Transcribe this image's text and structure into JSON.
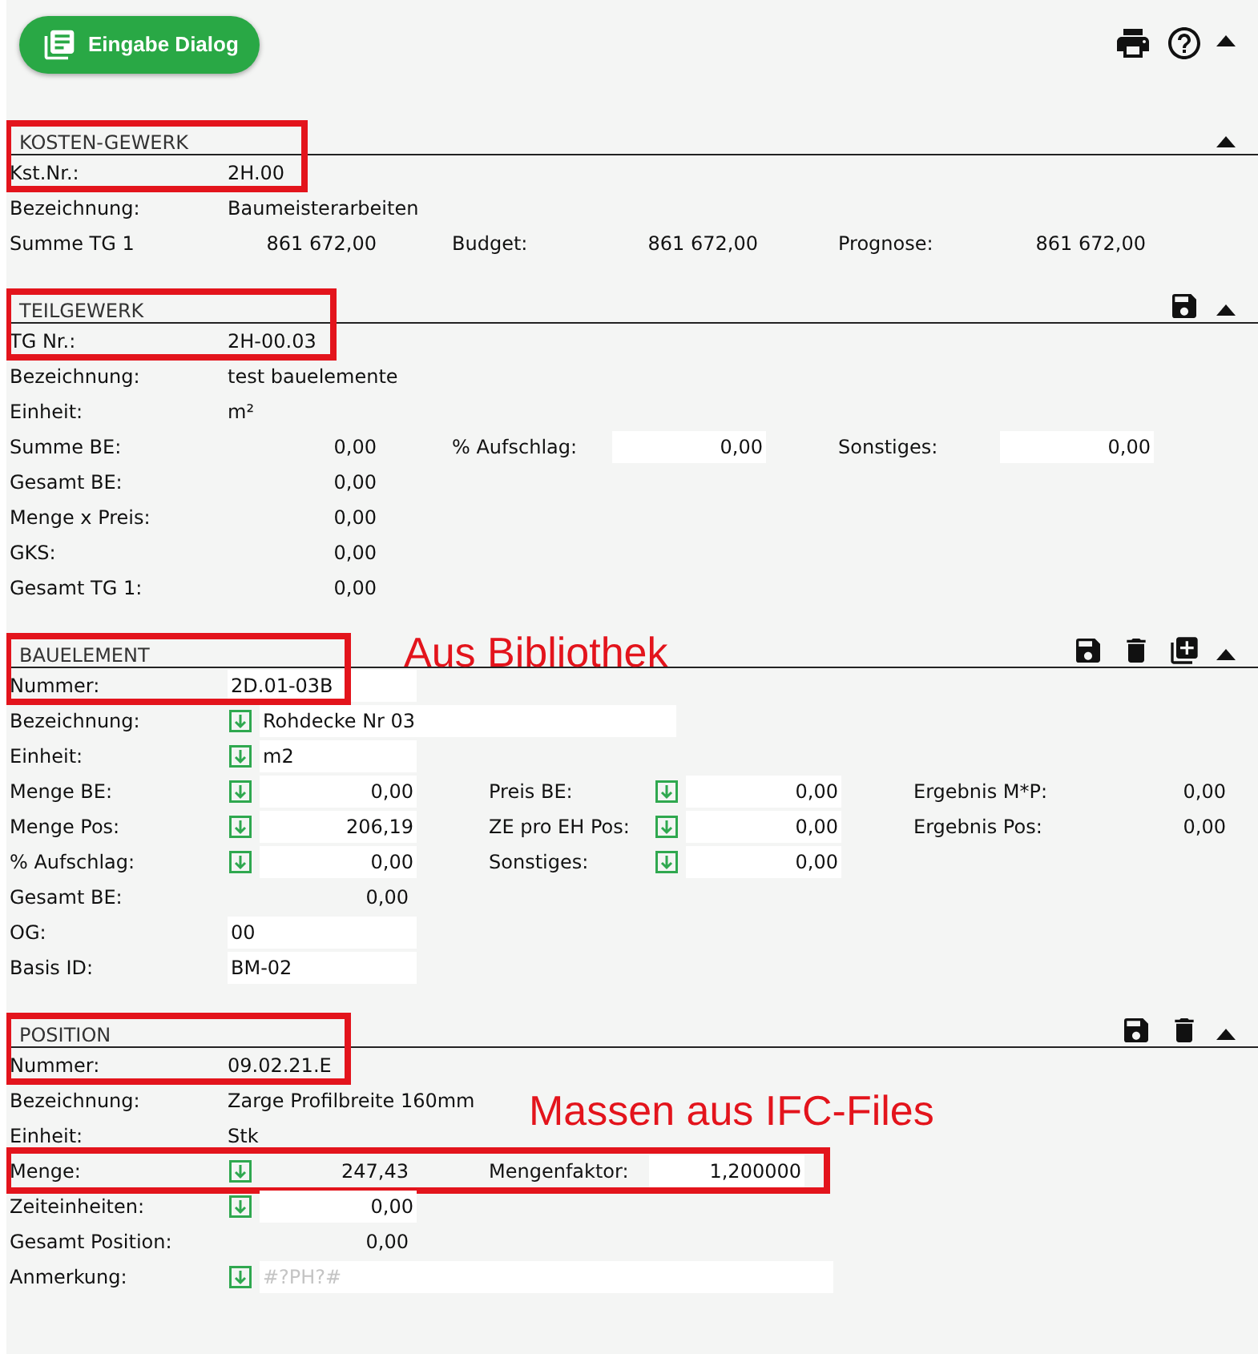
{
  "toolbar": {
    "button": "Eingabe Dialog",
    "actions": [
      {
        "kind": "print"
      },
      {
        "kind": "help"
      },
      {
        "kind": "collapse"
      }
    ]
  },
  "sections": [
    {
      "kind": "kosten",
      "title": "KOSTEN-GEWERK",
      "highlighted": true,
      "actions": [
        {
          "kind": "collapse"
        }
      ],
      "rows": [
        {
          "fields": [
            {
              "label": "Kst.Nr.:",
              "value": "2H.00",
              "kind": "text"
            }
          ]
        },
        {
          "fields": [
            {
              "label": "Bezeichnung:",
              "value": "Baumeisterarbeiten",
              "kind": "text"
            }
          ]
        },
        {
          "fields": [
            {
              "label": "Summe TG 1",
              "value": "861 672,00",
              "kind": "number"
            },
            {
              "label": "Budget:",
              "value": "861 672,00",
              "kind": "number"
            },
            {
              "label": "Prognose:",
              "value": "861 672,00",
              "kind": "number"
            }
          ]
        }
      ]
    },
    {
      "kind": "teilgewerk",
      "title": "TEILGEWERK",
      "highlighted": true,
      "actions": [
        {
          "kind": "save"
        },
        {
          "kind": "collapse"
        }
      ],
      "rows": [
        {
          "fields": [
            {
              "label": "TG Nr.:",
              "value": "2H-00.03",
              "kind": "text"
            }
          ]
        },
        {
          "fields": [
            {
              "label": "Bezeichnung:",
              "value": "test bauelemente",
              "kind": "text"
            }
          ]
        },
        {
          "fields": [
            {
              "label": "Einheit:",
              "value": "m²",
              "kind": "text"
            }
          ]
        },
        {
          "fields": [
            {
              "label": "Summe BE:",
              "value": "0,00",
              "kind": "number"
            },
            {
              "label": "% Aufschlag:",
              "value": "0,00",
              "kind": "input-number"
            },
            {
              "label": "Sonstiges:",
              "value": "0,00",
              "kind": "input-number"
            }
          ]
        },
        {
          "fields": [
            {
              "label": "Gesamt BE:",
              "value": "0,00",
              "kind": "number"
            }
          ]
        },
        {
          "fields": [
            {
              "label": "Menge x Preis:",
              "value": "0,00",
              "kind": "number"
            }
          ]
        },
        {
          "fields": [
            {
              "label": "GKS:",
              "value": "0,00",
              "kind": "number"
            }
          ]
        },
        {
          "fields": [
            {
              "label": "Gesamt TG 1:",
              "value": "0,00",
              "kind": "number"
            }
          ]
        }
      ]
    },
    {
      "kind": "bauelement",
      "title": "BAUELEMENT",
      "highlighted": true,
      "annotation": "Aus Bibliothek",
      "actions": [
        {
          "kind": "save"
        },
        {
          "kind": "delete"
        },
        {
          "kind": "add"
        },
        {
          "kind": "collapse"
        }
      ],
      "rows": [
        {
          "fields": [
            {
              "label": "Nummer:",
              "value": "2D.01-03B",
              "kind": "input-text"
            }
          ]
        },
        {
          "fields": [
            {
              "label": "Bezeichnung:",
              "value": "Rohdecke Nr 03",
              "kind": "wide-input",
              "import": true
            }
          ]
        },
        {
          "fields": [
            {
              "label": "Einheit:",
              "value": "m2",
              "kind": "input-text",
              "import": true
            }
          ]
        },
        {
          "fields": [
            {
              "label": "Menge BE:",
              "value": "0,00",
              "kind": "input-number",
              "import": true
            },
            {
              "label": "Preis BE:",
              "value": "0,00",
              "kind": "input-number",
              "import": true
            },
            {
              "label": "Ergebnis M*P:",
              "value": "0,00",
              "kind": "number"
            }
          ]
        },
        {
          "fields": [
            {
              "label": "Menge Pos:",
              "value": "206,19",
              "kind": "input-number",
              "import": true
            },
            {
              "label": "ZE pro EH Pos:",
              "value": "0,00",
              "kind": "input-number",
              "import": true
            },
            {
              "label": "Ergebnis Pos:",
              "value": "0,00",
              "kind": "number"
            }
          ]
        },
        {
          "fields": [
            {
              "label": "% Aufschlag:",
              "value": "0,00",
              "kind": "input-number",
              "import": true
            },
            {
              "label": "Sonstiges:",
              "value": "0,00",
              "kind": "input-number",
              "import": true
            }
          ]
        },
        {
          "fields": [
            {
              "label": "Gesamt BE:",
              "value": "0,00",
              "kind": "number"
            }
          ]
        },
        {
          "fields": [
            {
              "label": "OG:",
              "value": "00",
              "kind": "input-text"
            }
          ]
        },
        {
          "fields": [
            {
              "label": "Basis ID:",
              "value": "BM-02",
              "kind": "input-text"
            }
          ]
        }
      ]
    },
    {
      "kind": "position",
      "title": "POSITION",
      "highlighted": true,
      "annotation": "Massen aus IFC-Files",
      "actions": [
        {
          "kind": "save"
        },
        {
          "kind": "delete"
        },
        {
          "kind": "collapse"
        }
      ],
      "rows": [
        {
          "fields": [
            {
              "label": "Nummer:",
              "value": "09.02.21.E",
              "kind": "text"
            }
          ]
        },
        {
          "fields": [
            {
              "label": "Bezeichnung:",
              "value": "Zarge Profilbreite 160mm",
              "kind": "text"
            }
          ]
        },
        {
          "fields": [
            {
              "label": "Einheit:",
              "value": "Stk",
              "kind": "text"
            }
          ]
        },
        {
          "highlighted": true,
          "fields": [
            {
              "label": "Menge:",
              "value": "247,43",
              "kind": "number",
              "import": true
            },
            {
              "label": "Mengenfaktor:",
              "value": "1,200000",
              "kind": "input-number"
            }
          ]
        },
        {
          "fields": [
            {
              "label": "Zeiteinheiten:",
              "value": "0,00",
              "kind": "input-number",
              "import": true
            }
          ]
        },
        {
          "fields": [
            {
              "label": "Gesamt Position:",
              "value": "0,00",
              "kind": "number"
            }
          ]
        },
        {
          "fields": [
            {
              "label": "Anmerkung:",
              "placeholder": "#?PH?#",
              "kind": "wide-input",
              "import": true
            }
          ]
        }
      ]
    }
  ]
}
